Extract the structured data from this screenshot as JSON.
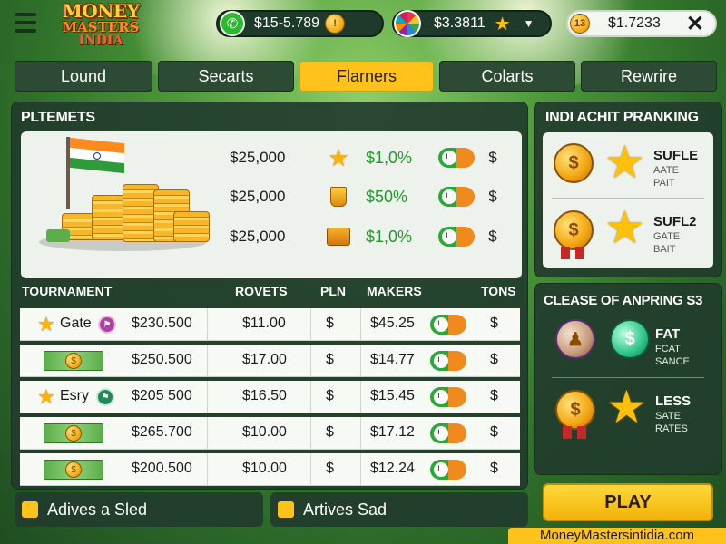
{
  "brand": {
    "line1": "MONEY",
    "line2": "MASTERS",
    "line3": "INDIA"
  },
  "topbar": {
    "balance1": "$15-5.789",
    "balance2": "$3.3811",
    "balance3": "$1.7233",
    "coin_badge": "13"
  },
  "tabs": [
    {
      "label": "Lound",
      "active": false
    },
    {
      "label": "Secarts",
      "active": false
    },
    {
      "label": "Flarners",
      "active": true
    },
    {
      "label": "Colarts",
      "active": false
    },
    {
      "label": "Rewrire",
      "active": false
    }
  ],
  "prizes": {
    "title": "PLTEMETS",
    "rows": [
      {
        "amount": "$25,000",
        "icon": "star-icon",
        "percent": "$1,0%",
        "dollar": "$"
      },
      {
        "amount": "$25,000",
        "icon": "crown-icon",
        "percent": "$50%",
        "dollar": "$"
      },
      {
        "amount": "$25,000",
        "icon": "pedestal-icon",
        "percent": "$1,0%",
        "dollar": "$"
      }
    ]
  },
  "tournament": {
    "headers": [
      "TOURNAMENT",
      "ROVETS",
      "PLN",
      "MAKERS",
      "TONS"
    ],
    "rows": [
      {
        "label": "Gate",
        "icon": "star-icon",
        "badge": "badge-icon",
        "prize": "$230.500",
        "rovets": "$11.00",
        "pln": "$",
        "makers": "$45.25",
        "tons": "$"
      },
      {
        "label": "",
        "icon": "cash-icon",
        "prize": "$250.500",
        "rovets": "$17.00",
        "pln": "$",
        "makers": "$14.77",
        "tons": "$"
      },
      {
        "label": "Esry",
        "icon": "star-icon",
        "badge": "badge-icon",
        "prize": "$205 500",
        "rovets": "$16.50",
        "pln": "$",
        "makers": "$15.45",
        "tons": "$"
      },
      {
        "label": "",
        "icon": "cash-icon",
        "prize": "$265.700",
        "rovets": "$10.00",
        "pln": "$",
        "makers": "$17.12",
        "tons": "$"
      },
      {
        "label": "",
        "icon": "cash-icon",
        "prize": "$200.500",
        "rovets": "$10.00",
        "pln": "$",
        "makers": "$12.24",
        "tons": "$"
      }
    ]
  },
  "bottom": {
    "left": "Adives a Sled",
    "right": "Artives Sad"
  },
  "ranking": {
    "title": "INDI ACHIT PRANKING",
    "items": [
      {
        "name": "SUFLE",
        "sub1": "AATE",
        "sub2": "PAIT"
      },
      {
        "name": "SUFL2",
        "sub1": "GATE",
        "sub2": "BAIT"
      }
    ]
  },
  "release": {
    "title": "CLEASE OF ANPRING S3",
    "items": [
      {
        "name": "FAT",
        "sub1": "FCAT",
        "sub2": "SANCE"
      },
      {
        "name": "LESS",
        "sub1": "SATE",
        "sub2": "RATES"
      }
    ]
  },
  "play_label": "PLAY",
  "footer": "MoneyMastersintidia.com"
}
